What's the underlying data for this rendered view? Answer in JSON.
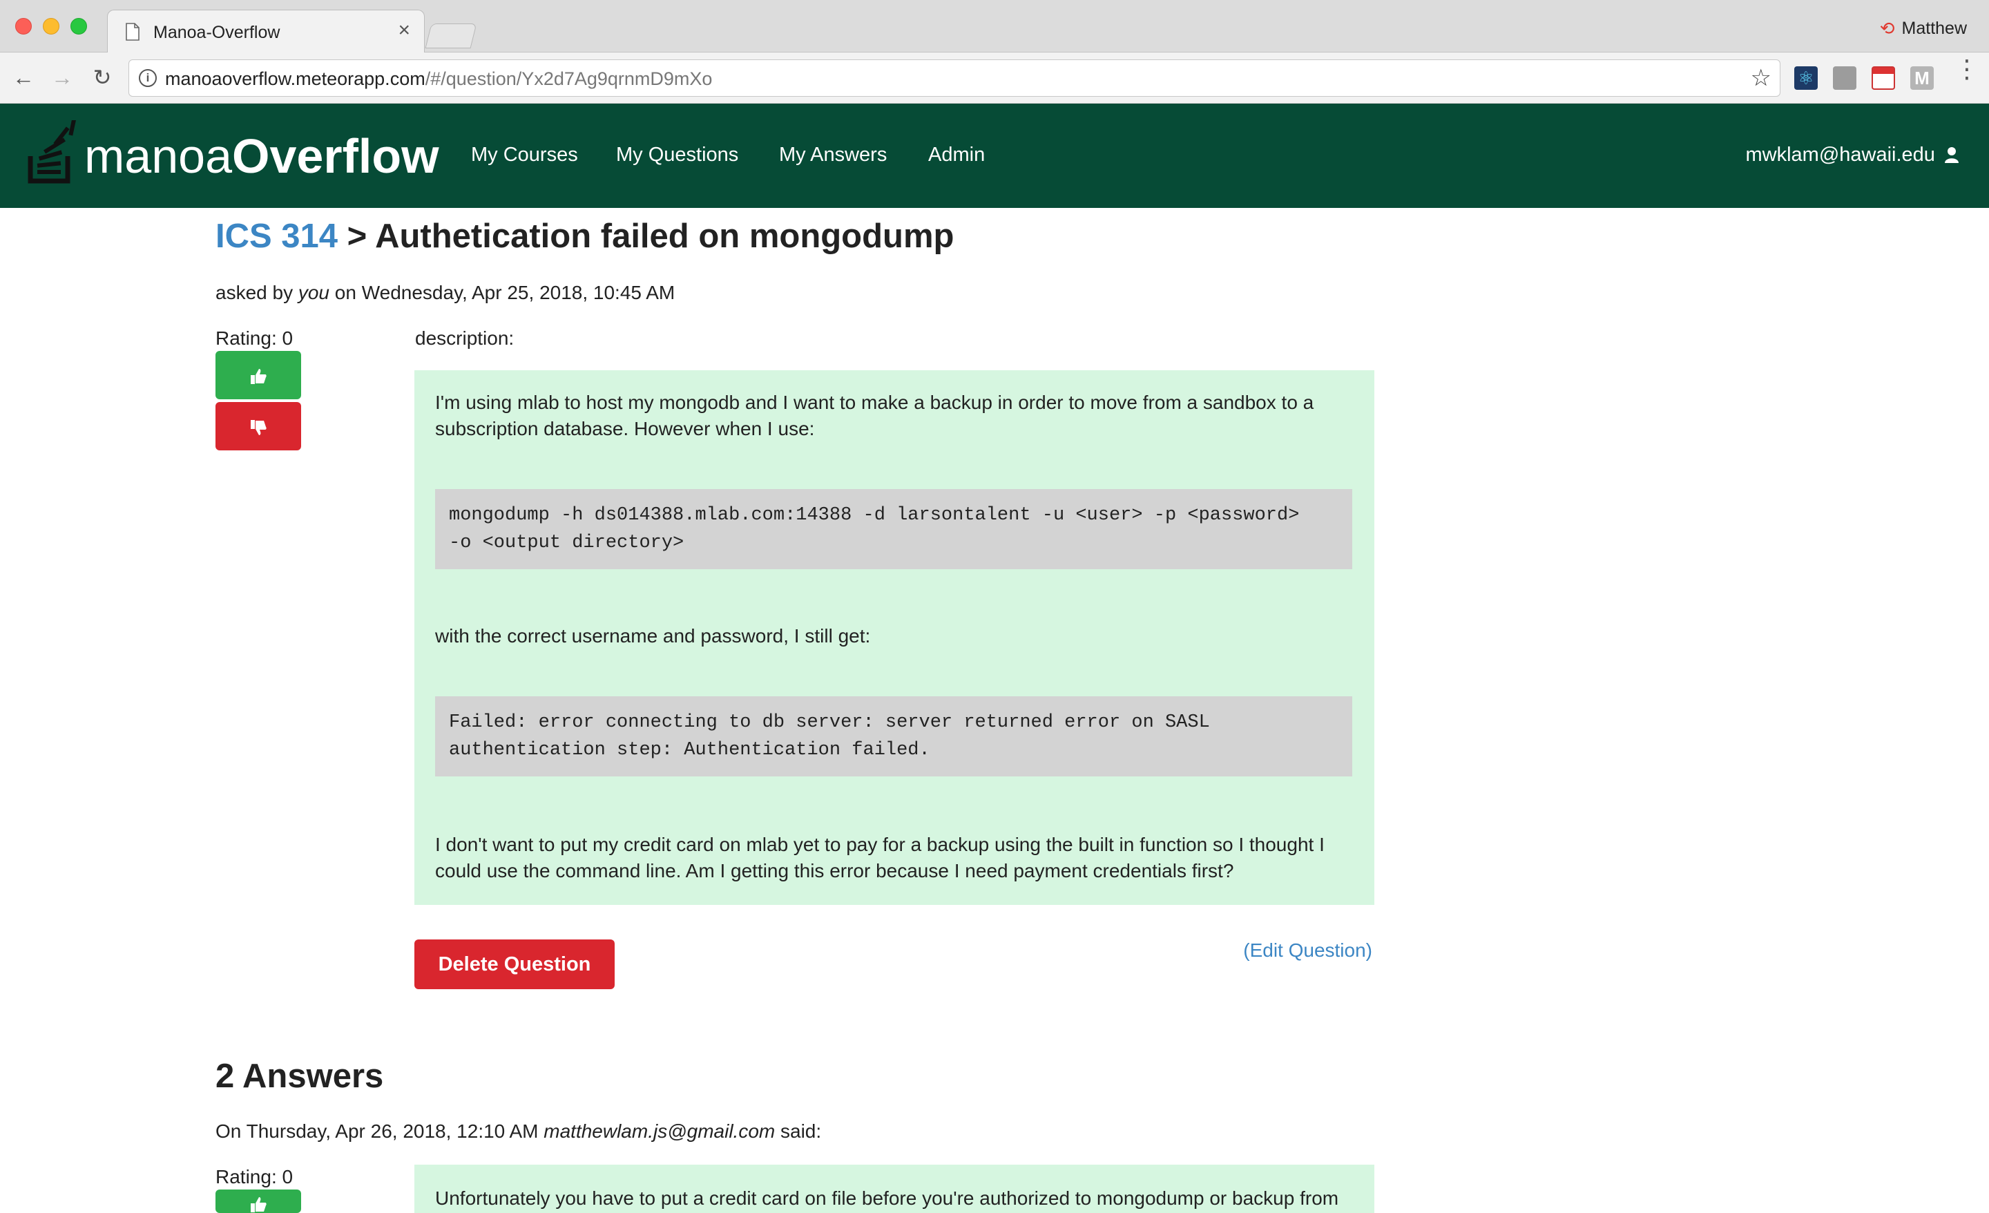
{
  "browser": {
    "tab_title": "Manoa-Overflow",
    "tab_close": "×",
    "profile_name": "Matthew",
    "url_host": "manoaoverflow.meteorapp.com",
    "url_path": "/#/question/Yx2d7Ag9qrnmD9mXo",
    "icons": [
      "back-arrow-icon",
      "forward-arrow-icon",
      "reload-icon",
      "info-icon",
      "star-icon",
      "react-devtools-icon",
      "extension-icon",
      "calendar-icon",
      "m-extension-icon",
      "menu-dots-icon"
    ]
  },
  "site": {
    "brand_light": "manoa",
    "brand_bold": "Overflow",
    "nav": [
      {
        "label": "My Courses"
      },
      {
        "label": "My Questions"
      },
      {
        "label": "My Answers"
      },
      {
        "label": "Admin"
      }
    ],
    "user_email": "mwklam@hawaii.edu",
    "colors": {
      "navbar": "#064b36",
      "link": "#3c86c4",
      "success": "#2eae4e",
      "danger": "#d9262e",
      "panel": "#d6f6e0",
      "code": "#d3d3d3"
    }
  },
  "question": {
    "course": "ICS 314",
    "separator": " > ",
    "title": "Authetication failed on mongodump",
    "asked_prefix": "asked by ",
    "asked_by": "you",
    "asked_suffix": " on Wednesday, Apr 25, 2018, 10:45 AM",
    "rating": "Rating: 0",
    "description_label": "description:",
    "para1": "I'm using mlab to host my mongodb and I want to make a backup in order to move from a sandbox to a subscription database. However when I use:",
    "code1": "mongodump -h ds014388.mlab.com:14388 -d larsontalent -u <user> -p <password>\n-o <output directory>",
    "para2": "with the correct username and password, I still get:",
    "code2": "Failed: error connecting to db server: server returned error on SASL\nauthentication step: Authentication failed.",
    "para3": "I don't want to put my credit card on mlab yet to pay for a backup using the built in function so I thought I could use the command line. Am I getting this error because I need payment credentials first?",
    "delete_label": "Delete Question",
    "edit_label": "(Edit Question)"
  },
  "answers": {
    "title": "2 Answers",
    "first": {
      "meta_prefix": "On Thursday, Apr 26, 2018, 12:10 AM ",
      "author": "matthewlam.js@gmail.com",
      "meta_suffix": " said:",
      "rating": "Rating: 0",
      "text": "Unfortunately you have to put a credit card on file before you're authorized to mongodump or backup from"
    }
  }
}
